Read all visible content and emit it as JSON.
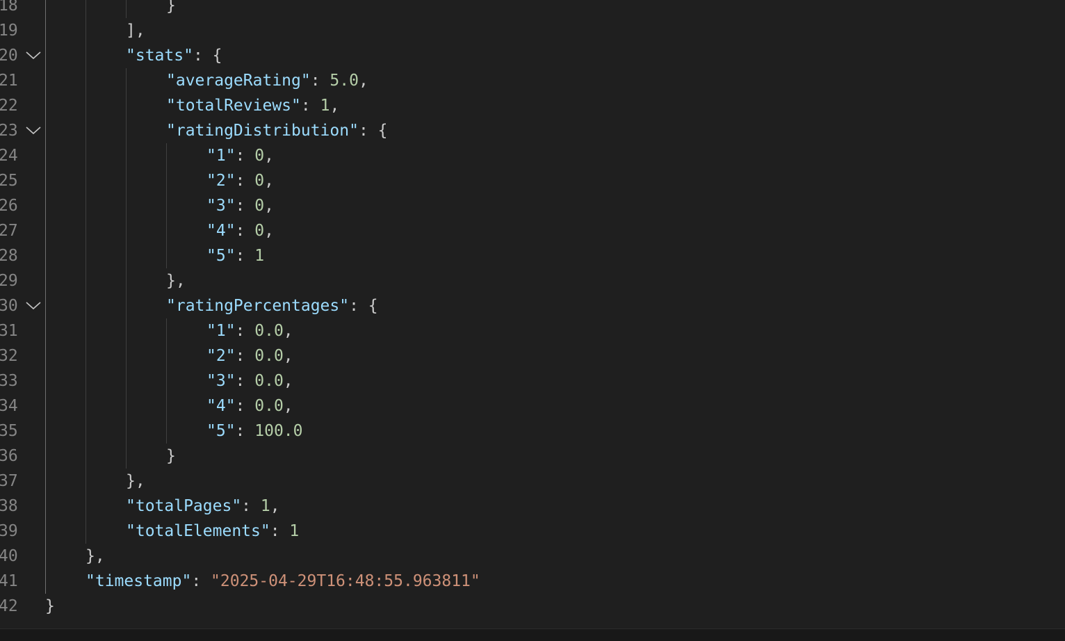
{
  "editor": {
    "colors": {
      "background": "#1f1f1f",
      "key": "#9cdcfe",
      "number": "#b5cea8",
      "string": "#ce9178",
      "punctuation": "#cccccc",
      "line_number": "#858585"
    },
    "lines": [
      {
        "n": "18",
        "indent": 3,
        "tokens": [
          {
            "t": "}",
            "c": "p"
          }
        ]
      },
      {
        "n": "19",
        "indent": 2,
        "tokens": [
          {
            "t": "],",
            "c": "p"
          }
        ]
      },
      {
        "n": "20",
        "indent": 2,
        "fold": true,
        "tokens": [
          {
            "t": "\"stats\"",
            "c": "k"
          },
          {
            "t": ": {",
            "c": "p"
          }
        ]
      },
      {
        "n": "21",
        "indent": 3,
        "tokens": [
          {
            "t": "\"averageRating\"",
            "c": "k"
          },
          {
            "t": ": ",
            "c": "p"
          },
          {
            "t": "5.0",
            "c": "n"
          },
          {
            "t": ",",
            "c": "p"
          }
        ]
      },
      {
        "n": "22",
        "indent": 3,
        "tokens": [
          {
            "t": "\"totalReviews\"",
            "c": "k"
          },
          {
            "t": ": ",
            "c": "p"
          },
          {
            "t": "1",
            "c": "n"
          },
          {
            "t": ",",
            "c": "p"
          }
        ]
      },
      {
        "n": "23",
        "indent": 3,
        "fold": true,
        "tokens": [
          {
            "t": "\"ratingDistribution\"",
            "c": "k"
          },
          {
            "t": ": {",
            "c": "p"
          }
        ]
      },
      {
        "n": "24",
        "indent": 4,
        "tokens": [
          {
            "t": "\"1\"",
            "c": "k"
          },
          {
            "t": ": ",
            "c": "p"
          },
          {
            "t": "0",
            "c": "n"
          },
          {
            "t": ",",
            "c": "p"
          }
        ]
      },
      {
        "n": "25",
        "indent": 4,
        "tokens": [
          {
            "t": "\"2\"",
            "c": "k"
          },
          {
            "t": ": ",
            "c": "p"
          },
          {
            "t": "0",
            "c": "n"
          },
          {
            "t": ",",
            "c": "p"
          }
        ]
      },
      {
        "n": "26",
        "indent": 4,
        "tokens": [
          {
            "t": "\"3\"",
            "c": "k"
          },
          {
            "t": ": ",
            "c": "p"
          },
          {
            "t": "0",
            "c": "n"
          },
          {
            "t": ",",
            "c": "p"
          }
        ]
      },
      {
        "n": "27",
        "indent": 4,
        "tokens": [
          {
            "t": "\"4\"",
            "c": "k"
          },
          {
            "t": ": ",
            "c": "p"
          },
          {
            "t": "0",
            "c": "n"
          },
          {
            "t": ",",
            "c": "p"
          }
        ]
      },
      {
        "n": "28",
        "indent": 4,
        "tokens": [
          {
            "t": "\"5\"",
            "c": "k"
          },
          {
            "t": ": ",
            "c": "p"
          },
          {
            "t": "1",
            "c": "n"
          }
        ]
      },
      {
        "n": "29",
        "indent": 3,
        "tokens": [
          {
            "t": "},",
            "c": "p"
          }
        ]
      },
      {
        "n": "30",
        "indent": 3,
        "fold": true,
        "tokens": [
          {
            "t": "\"ratingPercentages\"",
            "c": "k"
          },
          {
            "t": ": {",
            "c": "p"
          }
        ]
      },
      {
        "n": "31",
        "indent": 4,
        "tokens": [
          {
            "t": "\"1\"",
            "c": "k"
          },
          {
            "t": ": ",
            "c": "p"
          },
          {
            "t": "0.0",
            "c": "n"
          },
          {
            "t": ",",
            "c": "p"
          }
        ]
      },
      {
        "n": "32",
        "indent": 4,
        "tokens": [
          {
            "t": "\"2\"",
            "c": "k"
          },
          {
            "t": ": ",
            "c": "p"
          },
          {
            "t": "0.0",
            "c": "n"
          },
          {
            "t": ",",
            "c": "p"
          }
        ]
      },
      {
        "n": "33",
        "indent": 4,
        "tokens": [
          {
            "t": "\"3\"",
            "c": "k"
          },
          {
            "t": ": ",
            "c": "p"
          },
          {
            "t": "0.0",
            "c": "n"
          },
          {
            "t": ",",
            "c": "p"
          }
        ]
      },
      {
        "n": "34",
        "indent": 4,
        "tokens": [
          {
            "t": "\"4\"",
            "c": "k"
          },
          {
            "t": ": ",
            "c": "p"
          },
          {
            "t": "0.0",
            "c": "n"
          },
          {
            "t": ",",
            "c": "p"
          }
        ]
      },
      {
        "n": "35",
        "indent": 4,
        "tokens": [
          {
            "t": "\"5\"",
            "c": "k"
          },
          {
            "t": ": ",
            "c": "p"
          },
          {
            "t": "100.0",
            "c": "n"
          }
        ]
      },
      {
        "n": "36",
        "indent": 3,
        "tokens": [
          {
            "t": "}",
            "c": "p"
          }
        ]
      },
      {
        "n": "37",
        "indent": 2,
        "tokens": [
          {
            "t": "},",
            "c": "p"
          }
        ]
      },
      {
        "n": "38",
        "indent": 2,
        "tokens": [
          {
            "t": "\"totalPages\"",
            "c": "k"
          },
          {
            "t": ": ",
            "c": "p"
          },
          {
            "t": "1",
            "c": "n"
          },
          {
            "t": ",",
            "c": "p"
          }
        ]
      },
      {
        "n": "39",
        "indent": 2,
        "tokens": [
          {
            "t": "\"totalElements\"",
            "c": "k"
          },
          {
            "t": ": ",
            "c": "p"
          },
          {
            "t": "1",
            "c": "n"
          }
        ]
      },
      {
        "n": "40",
        "indent": 1,
        "tokens": [
          {
            "t": "},",
            "c": "p"
          }
        ]
      },
      {
        "n": "41",
        "indent": 1,
        "tokens": [
          {
            "t": "\"timestamp\"",
            "c": "k"
          },
          {
            "t": ": ",
            "c": "p"
          },
          {
            "t": "\"2025-04-29T16:48:55.963811\"",
            "c": "s"
          }
        ]
      },
      {
        "n": "42",
        "indent": 0,
        "tokens": [
          {
            "t": "}",
            "c": "p"
          }
        ]
      }
    ]
  },
  "statusbar": {
    "icons": [
      "sync-icon",
      "panel-icon",
      "feedback-icon",
      "bell-icon"
    ]
  }
}
